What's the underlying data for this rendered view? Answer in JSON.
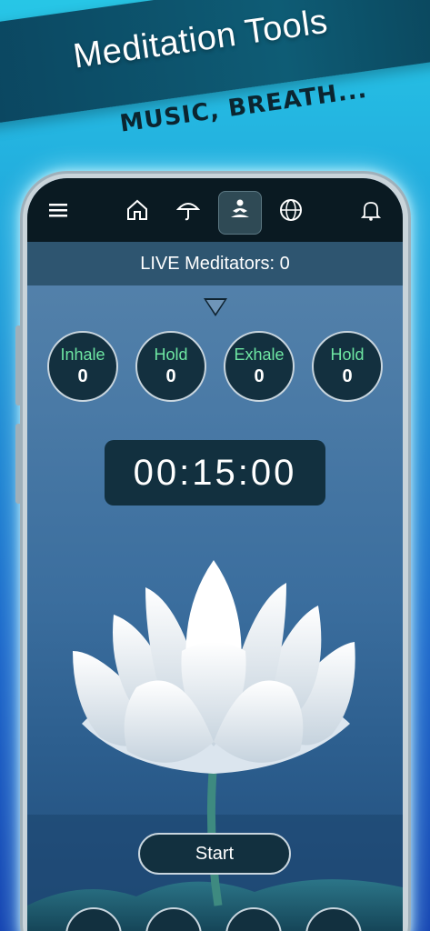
{
  "promo": {
    "headline": "Meditation Tools",
    "subline": "MUSIC, BREATH..."
  },
  "nav": {
    "items": [
      {
        "icon": "menu-icon"
      },
      {
        "icon": "home-icon"
      },
      {
        "icon": "umbrella-icon"
      },
      {
        "icon": "meditation-icon",
        "active": true
      },
      {
        "icon": "globe-icon"
      },
      {
        "icon": "bell-icon"
      }
    ]
  },
  "live": {
    "text": "LIVE Meditators: 0"
  },
  "phases": [
    {
      "label": "Inhale",
      "value": "0"
    },
    {
      "label": "Hold",
      "value": "0"
    },
    {
      "label": "Exhale",
      "value": "0"
    },
    {
      "label": "Hold",
      "value": "0"
    }
  ],
  "timer": {
    "value": "00:15:00"
  },
  "start": {
    "label": "Start"
  },
  "colors": {
    "accent_green": "#6ee7a3",
    "panel_dark": "#12303f",
    "topbar": "#0a1a22"
  }
}
